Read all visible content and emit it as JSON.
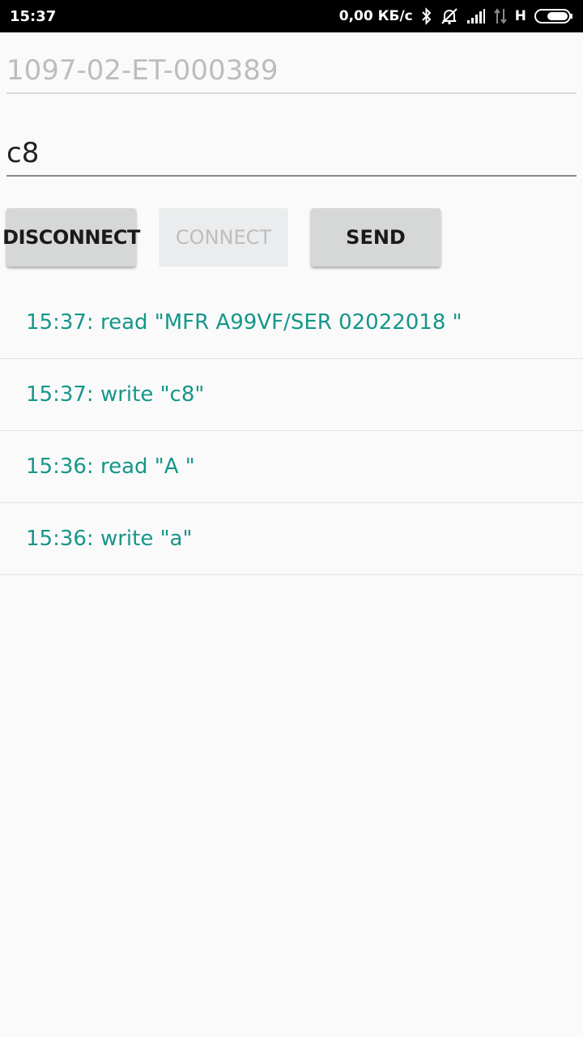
{
  "status_bar": {
    "time": "15:37",
    "network_speed": "0,00 КБ/с",
    "network_type": "H",
    "icons": [
      "bluetooth-icon",
      "notifications-off-icon",
      "signal-icon",
      "data-transfer-icon",
      "battery-icon"
    ]
  },
  "form": {
    "address_value": "1097-02-ET-000389",
    "command_value": "c8"
  },
  "buttons": {
    "disconnect": "DISCONNECT",
    "connect": "CONNECT",
    "send": "SEND"
  },
  "log": [
    "15:37: read \"MFR A99VF/SER 02022018 \"",
    "15:37: write \"c8\"",
    "15:36: read \"A \"",
    "15:36: write \"a\""
  ],
  "colors": {
    "log_text": "#16968a",
    "status_bar": "#000000",
    "background": "#fafafa"
  }
}
